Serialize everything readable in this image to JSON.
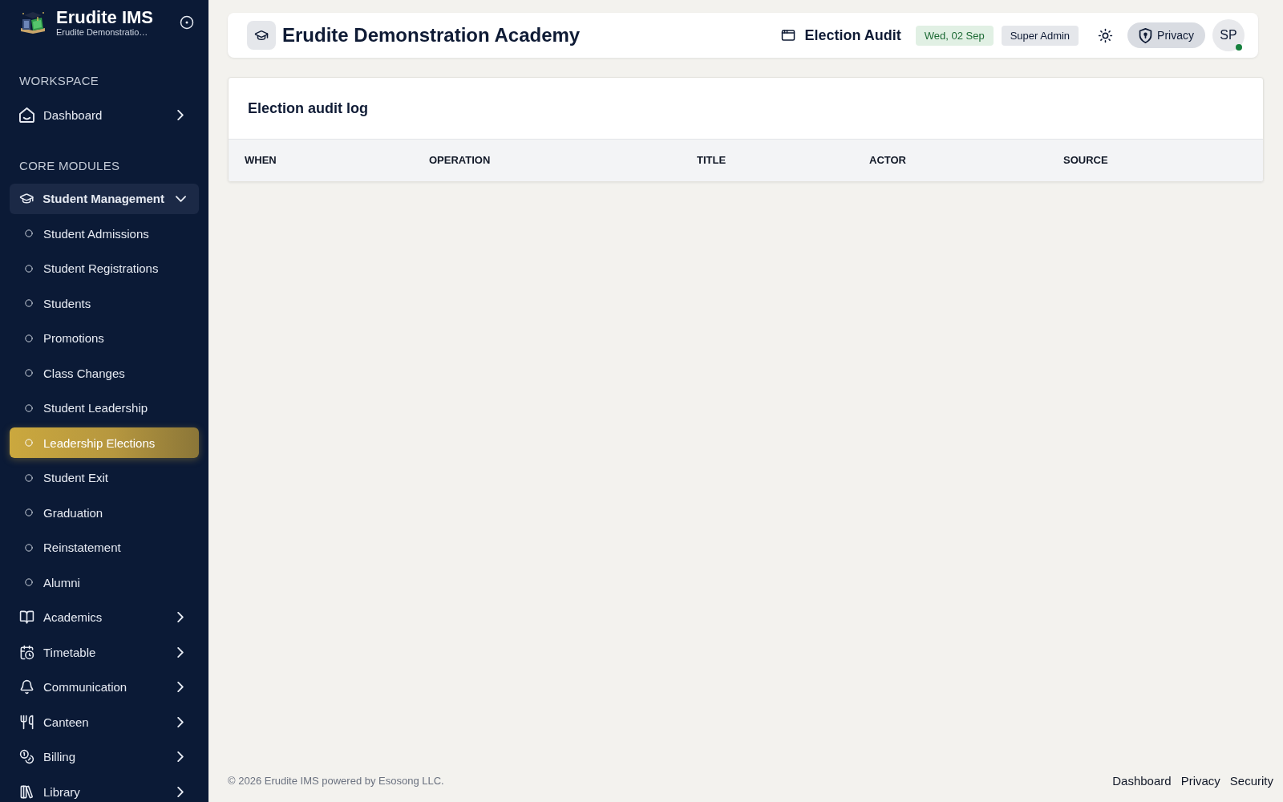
{
  "sidebar": {
    "brand": {
      "title": "Erudite IMS",
      "subtitle": "Erudite Demonstratio…"
    },
    "sections": [
      {
        "heading": "WORKSPACE",
        "items": [
          {
            "label": "Dashboard",
            "expanded": false
          }
        ]
      },
      {
        "heading": "CORE MODULES",
        "items": [
          {
            "label": "Student Management",
            "expanded": true,
            "children": [
              {
                "label": "Student Admissions",
                "selected": false
              },
              {
                "label": "Student Registrations",
                "selected": false
              },
              {
                "label": "Students",
                "selected": false
              },
              {
                "label": "Promotions",
                "selected": false
              },
              {
                "label": "Class Changes",
                "selected": false
              },
              {
                "label": "Student Leadership",
                "selected": false
              },
              {
                "label": "Leadership Elections",
                "selected": true
              },
              {
                "label": "Student Exit",
                "selected": false
              },
              {
                "label": "Graduation",
                "selected": false
              },
              {
                "label": "Reinstatement",
                "selected": false
              },
              {
                "label": "Alumni",
                "selected": false
              }
            ]
          },
          {
            "label": "Academics",
            "expanded": false
          },
          {
            "label": "Timetable",
            "expanded": false
          },
          {
            "label": "Communication",
            "expanded": false
          },
          {
            "label": "Canteen",
            "expanded": false
          },
          {
            "label": "Billing",
            "expanded": false
          },
          {
            "label": "Library",
            "expanded": false
          }
        ]
      }
    ]
  },
  "header": {
    "title": "Erudite Demonstration Academy",
    "page": "Election Audit",
    "date": "Wed, 02 Sep",
    "role": "Super Admin",
    "privacy": "Privacy",
    "avatar": {
      "initials": "SP",
      "online": true
    }
  },
  "audit_card": {
    "title": "Election audit log",
    "table": {
      "columns": [
        "WHEN",
        "OPERATION",
        "TITLE",
        "ACTOR",
        "SOURCE"
      ]
    }
  },
  "footer": {
    "copyright": "© 2026 Erudite IMS powered by Esosong LLC.",
    "links": [
      "Dashboard",
      "Privacy",
      "Security"
    ]
  }
}
